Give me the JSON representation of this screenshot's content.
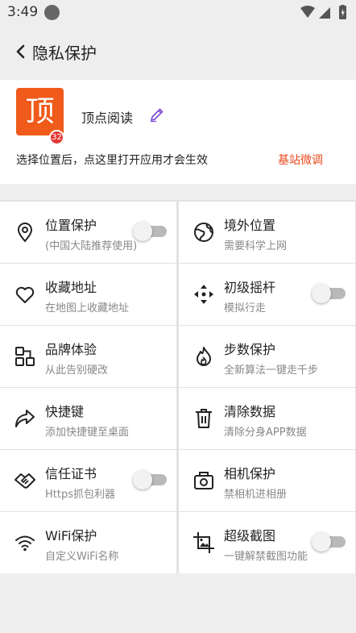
{
  "status_bar": {
    "time": "3:49"
  },
  "header": {
    "title": "隐私保护",
    "back_icon": "chevron-left-icon"
  },
  "app": {
    "logo_char": "顶",
    "badge": "32",
    "name": "顶点阅读",
    "edit_icon": "pencil-icon",
    "hint": "选择位置后，点这里打开应用才会生效",
    "action_link": "基站微调"
  },
  "colors": {
    "accent": "#e8471b",
    "logo_bg": "#f05a1a",
    "badge": "#e53935",
    "edit_icon": "#7b4bd6"
  },
  "features": [
    {
      "title": "位置保护",
      "subtitle": "(中国大陆推荐使用)",
      "icon": "location-pin-icon",
      "toggle": false
    },
    {
      "title": "境外位置",
      "subtitle": "需要科学上网",
      "icon": "globe-icon",
      "toggle": null
    },
    {
      "title": "收藏地址",
      "subtitle": "在地图上收藏地址",
      "icon": "heart-icon",
      "toggle": null
    },
    {
      "title": "初级摇杆",
      "subtitle": "模拟行走",
      "icon": "joystick-arrows-icon",
      "toggle": false
    },
    {
      "title": "品牌体验",
      "subtitle": "从此告别硬改",
      "icon": "brand-squares-icon",
      "toggle": null
    },
    {
      "title": "步数保护",
      "subtitle": "全新算法一键走千步",
      "icon": "flame-icon",
      "toggle": null
    },
    {
      "title": "快捷键",
      "subtitle": "添加快捷键至桌面",
      "icon": "share-arrow-icon",
      "toggle": null
    },
    {
      "title": "清除数据",
      "subtitle": "清除分身APP数据",
      "icon": "trash-icon",
      "toggle": null
    },
    {
      "title": "信任证书",
      "subtitle": "Https抓包利器",
      "icon": "handshake-icon",
      "toggle": false
    },
    {
      "title": "相机保护",
      "subtitle": "禁相机进相册",
      "icon": "camera-icon",
      "toggle": null
    },
    {
      "title": "WiFi保护",
      "subtitle": "自定义WiFi名称",
      "icon": "wifi-icon",
      "toggle": null
    },
    {
      "title": "超级截图",
      "subtitle": "一键解禁截图功能",
      "icon": "screenshot-crop-icon",
      "toggle": false
    }
  ]
}
